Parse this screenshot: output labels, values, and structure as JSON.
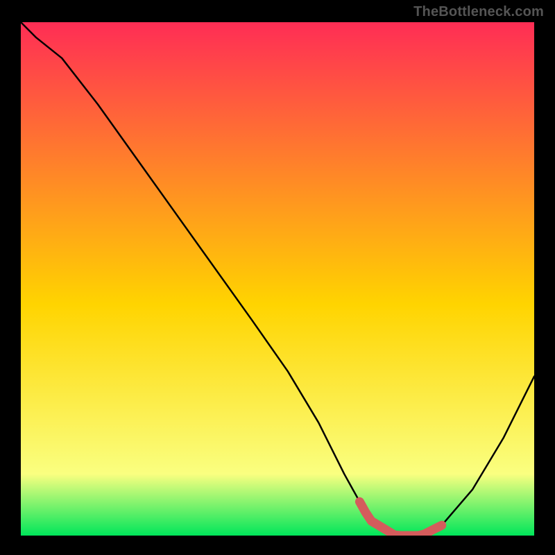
{
  "attribution": "TheBottleneck.com",
  "colors": {
    "bg": "#000000",
    "grad_top": "#ff2d55",
    "grad_mid": "#ffd400",
    "grad_near_bottom": "#faff80",
    "grad_bottom": "#00e65a",
    "curve": "#000000",
    "highlight": "#d45c5c",
    "attribution_text": "#555555"
  },
  "chart_data": {
    "type": "line",
    "title": "",
    "xlabel": "",
    "ylabel": "",
    "xlim": [
      0,
      100
    ],
    "ylim": [
      0,
      100
    ],
    "grid": false,
    "legend": false,
    "series": [
      {
        "name": "bottleneck-curve",
        "x": [
          0,
          3,
          8,
          15,
          25,
          35,
          45,
          52,
          58,
          63,
          68,
          73,
          78,
          82,
          88,
          94,
          100
        ],
        "y": [
          100,
          97,
          93,
          84,
          70,
          56,
          42,
          32,
          22,
          12,
          3,
          0,
          0,
          2,
          9,
          19,
          31
        ]
      }
    ],
    "annotations": [
      {
        "name": "optimal-range-highlight",
        "x_start": 66,
        "x_end": 82,
        "y": 0
      }
    ]
  }
}
